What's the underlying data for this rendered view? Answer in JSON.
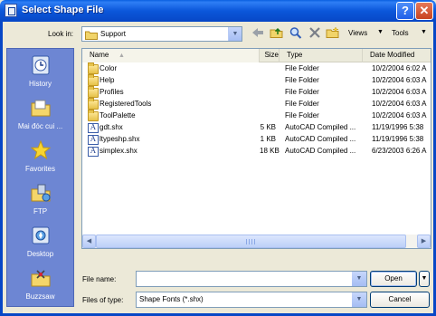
{
  "window": {
    "title": "Select Shape File",
    "help_glyph": "?",
    "close_glyph": "✕"
  },
  "lookin": {
    "label": "Look in:",
    "value": "Support",
    "arrow": "▼"
  },
  "toolbar": {
    "views_label": "Views",
    "tools_label": "Tools",
    "arrow": "▼"
  },
  "places": [
    {
      "label": "History",
      "icon": "history-icon"
    },
    {
      "label": "Mai đóc cui ...",
      "icon": "my-documents-icon"
    },
    {
      "label": "Favorites",
      "icon": "favorites-icon"
    },
    {
      "label": "FTP",
      "icon": "ftp-icon"
    },
    {
      "label": "Desktop",
      "icon": "desktop-icon"
    },
    {
      "label": "Buzzsaw",
      "icon": "buzzsaw-icon"
    }
  ],
  "columns": {
    "name": "Name",
    "size": "Size",
    "type": "Type",
    "date": "Date Modified",
    "sort_arrow": "▲"
  },
  "files": [
    {
      "name": "Color",
      "size": "",
      "type": "File Folder",
      "date": "10/2/2004 6:02 A",
      "kind": "folder"
    },
    {
      "name": "Help",
      "size": "",
      "type": "File Folder",
      "date": "10/2/2004 6:03 A",
      "kind": "folder"
    },
    {
      "name": "Profiles",
      "size": "",
      "type": "File Folder",
      "date": "10/2/2004 6:03 A",
      "kind": "folder"
    },
    {
      "name": "RegisteredTools",
      "size": "",
      "type": "File Folder",
      "date": "10/2/2004 6:03 A",
      "kind": "folder"
    },
    {
      "name": "ToolPalette",
      "size": "",
      "type": "File Folder",
      "date": "10/2/2004 6:03 A",
      "kind": "folder"
    },
    {
      "name": "gdt.shx",
      "size": "5 KB",
      "type": "AutoCAD Compiled ...",
      "date": "11/19/1996 5:38",
      "kind": "shx"
    },
    {
      "name": "ltypeshp.shx",
      "size": "1 KB",
      "type": "AutoCAD Compiled ...",
      "date": "11/19/1996 5:38",
      "kind": "shx"
    },
    {
      "name": "simplex.shx",
      "size": "18 KB",
      "type": "AutoCAD Compiled ...",
      "date": "6/23/2003 6:26 A",
      "kind": "shx"
    }
  ],
  "scroll": {
    "left": "◀",
    "right": "▶"
  },
  "bottom": {
    "filename_label": "File name:",
    "filename_value": "",
    "filetype_label": "Files of type:",
    "filetype_value": "Shape Fonts (*.shx)",
    "open_label": "Open",
    "cancel_label": "Cancel",
    "arrow": "▼"
  }
}
